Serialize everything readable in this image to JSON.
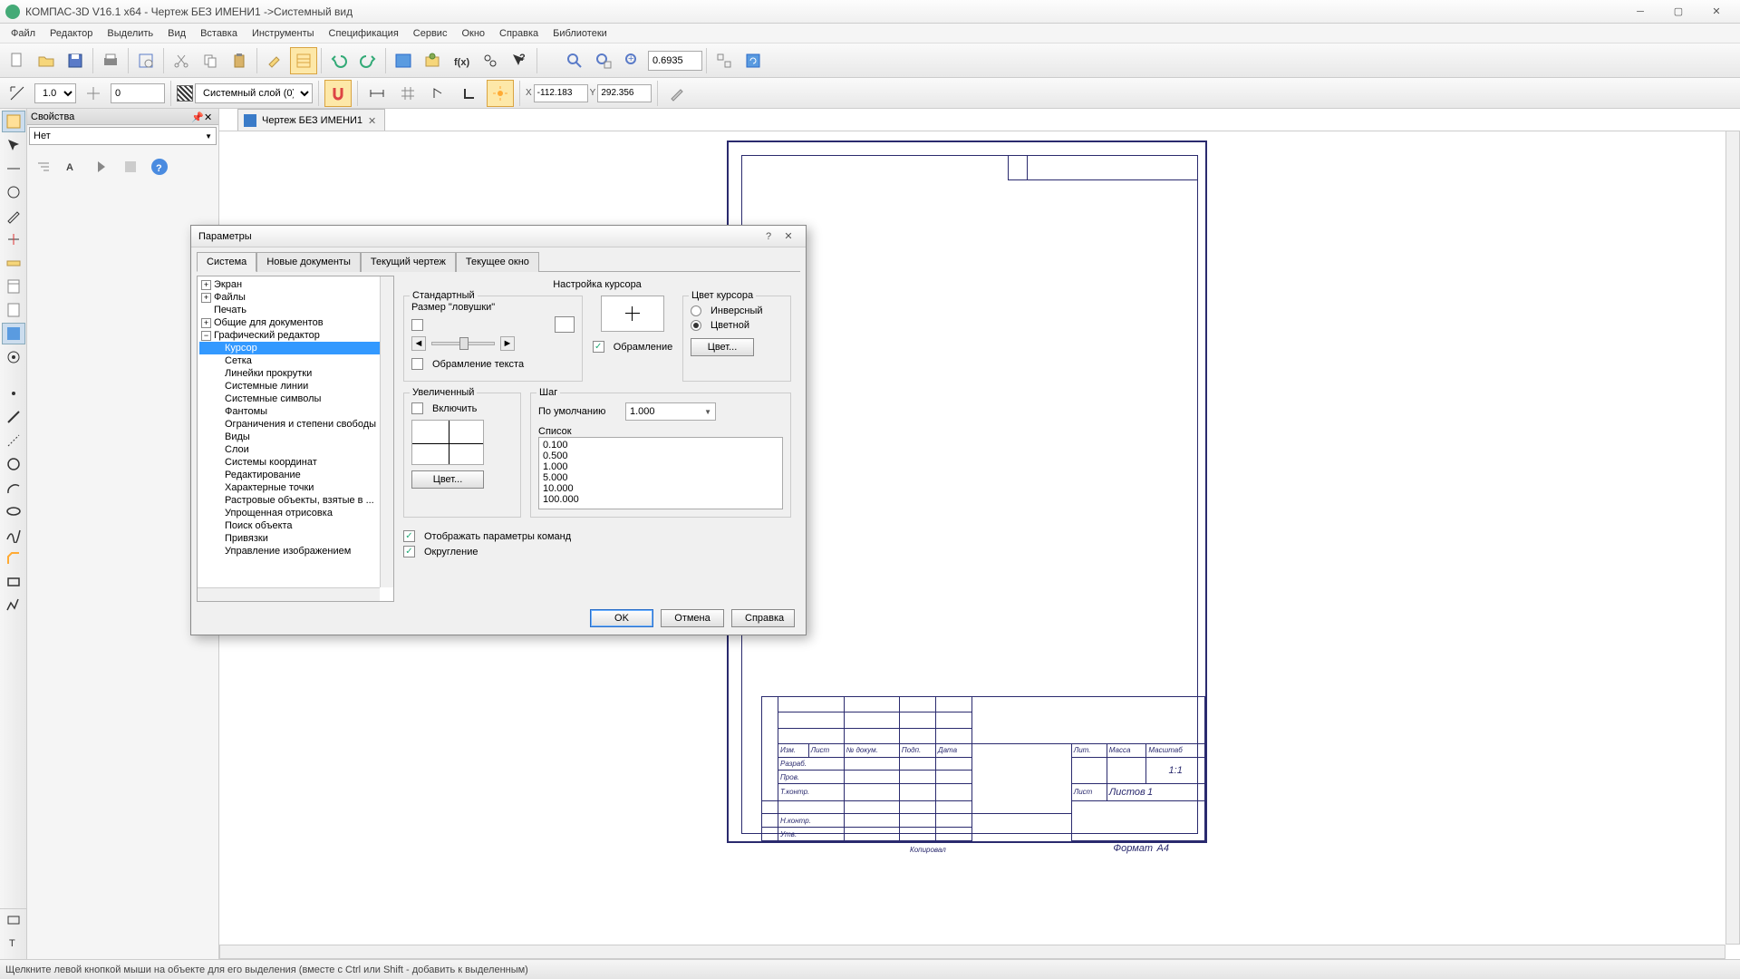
{
  "app": {
    "title": "КОМПАС-3D V16.1 x64 - Чертеж БЕЗ ИМЕНИ1 ->Системный вид"
  },
  "menu": [
    "Файл",
    "Редактор",
    "Выделить",
    "Вид",
    "Вставка",
    "Инструменты",
    "Спецификация",
    "Сервис",
    "Окно",
    "Справка",
    "Библиотеки"
  ],
  "toolbar1": {
    "zoom_value": "0.6935"
  },
  "toolbar2": {
    "scale": "1.0",
    "step": "0",
    "layer": "Системный слой (0)",
    "x": "-112.183",
    "y": "292.356"
  },
  "props": {
    "title": "Свойства",
    "sel": "Нет"
  },
  "doc_tab": {
    "name": "Чертеж БЕЗ ИМЕНИ1"
  },
  "dialog": {
    "title": "Параметры",
    "tabs": [
      "Система",
      "Новые документы",
      "Текущий чертеж",
      "Текущее окно"
    ],
    "tree": {
      "top": [
        "Экран",
        "Файлы",
        "Печать",
        "Общие для документов",
        "Графический редактор"
      ],
      "ge_children": [
        "Курсор",
        "Сетка",
        "Линейки прокрутки",
        "Системные линии",
        "Системные символы",
        "Фантомы",
        "Ограничения и степени свободы",
        "Виды",
        "Слои",
        "Системы координат",
        "Редактирование",
        "Характерные точки",
        "Растровые объекты, взятые в ...",
        "Упрощенная отрисовка",
        "Поиск объекта",
        "Привязки",
        "Управление изображением"
      ]
    },
    "settings": {
      "header": "Настройка курсора",
      "std_group": "Стандартный",
      "trap_size": "Размер \"ловушки\"",
      "cursor_color_group": "Цвет курсора",
      "inv": "Инверсный",
      "colored": "Цветной",
      "color_btn": "Цвет...",
      "text_frame": "Обрамление текста",
      "frame": "Обрамление",
      "enlarged_group": "Увеличенный",
      "enable": "Включить",
      "color_btn2": "Цвет...",
      "step_group": "Шаг",
      "default_lbl": "По умолчанию",
      "default_val": "1.000",
      "list_lbl": "Список",
      "list": [
        "0.100",
        "0.500",
        "1.000",
        "5.000",
        "10.000",
        "100.000"
      ],
      "show_params": "Отображать параметры команд",
      "rounding": "Округление"
    },
    "buttons": {
      "ok": "OK",
      "cancel": "Отмена",
      "help": "Справка"
    }
  },
  "titleblock": {
    "izm": "Изм.",
    "list": "Лист",
    "ndoc": "№ докум.",
    "podp": "Подп.",
    "data": "Дата",
    "razrab": "Разраб.",
    "prov": "Пров.",
    "tkontr": "Т.контр.",
    "nkontr": "Н.контр.",
    "utv": "Утв.",
    "lit": "Лит.",
    "massa": "Масса",
    "masshtab": "Масштаб",
    "mval": "1:1",
    "list2": "Лист",
    "listov": "Листов",
    "l1": "1",
    "kopiroval": "Копировал",
    "format": "Формат",
    "a4": "A4"
  },
  "status": "Щелкните левой кнопкой мыши на объекте для его выделения (вместе с Ctrl или Shift - добавить к выделенным)"
}
